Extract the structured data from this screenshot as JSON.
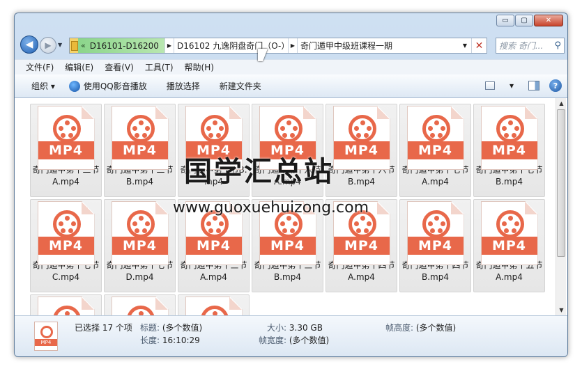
{
  "window": {
    "minimize": "▭",
    "maximize": "▢",
    "close": "✕"
  },
  "address": {
    "history_glyph": "«",
    "crumbs": [
      "D16101-D16200",
      "D16102 九逸阴盘奇门（O-）",
      "奇门遁甲中级班课程一期"
    ],
    "sep_glyph": "▶",
    "dropdown_glyph": "▼",
    "refresh_glyph": "✕"
  },
  "search": {
    "placeholder": "搜索 奇门...",
    "icon": "search-icon"
  },
  "menu": [
    "文件(F)",
    "编辑(E)",
    "查看(V)",
    "工具(T)",
    "帮助(H)"
  ],
  "toolbar": {
    "organize": "组织 ▾",
    "qq_play": "使用QQ影音播放",
    "play_selection": "播放选择",
    "new_folder": "新建文件夹",
    "help": "?"
  },
  "files": [
    {
      "name": "奇门遁甲第十二节A.mp4",
      "badge": "MP4"
    },
    {
      "name": "奇门遁甲第十二节B.mp4",
      "badge": "MP4"
    },
    {
      "name": "奇门遁甲第十节B.mp4",
      "badge": "MP4"
    },
    {
      "name": "奇门遁甲第十六节A.mp4",
      "badge": "MP4"
    },
    {
      "name": "奇门遁甲第十六节B.mp4",
      "badge": "MP4"
    },
    {
      "name": "奇门遁甲第十七节A.mp4",
      "badge": "MP4"
    },
    {
      "name": "奇门遁甲第十七节B.mp4",
      "badge": "MP4"
    },
    {
      "name": "奇门遁甲第十七节C.mp4",
      "badge": "MP4"
    },
    {
      "name": "奇门遁甲第十七节D.mp4",
      "badge": "MP4"
    },
    {
      "name": "奇门遁甲第十三节A.mp4",
      "badge": "MP4"
    },
    {
      "name": "奇门遁甲第十三节B.mp4",
      "badge": "MP4"
    },
    {
      "name": "奇门遁甲第十四节A.mp4",
      "badge": "MP4"
    },
    {
      "name": "奇门遁甲第十四节B.mp4",
      "badge": "MP4"
    },
    {
      "name": "奇门遁甲第十五节A.mp4",
      "badge": "MP4"
    },
    {
      "name": "",
      "badge": ""
    },
    {
      "name": "",
      "badge": ""
    },
    {
      "name": "",
      "badge": ""
    }
  ],
  "details": {
    "selected": "已选择 17 个项",
    "title_key": "标题:",
    "title_val": "(多个数值)",
    "size_key": "大小:",
    "size_val": "3.30 GB",
    "frame_h_key": "帧高度:",
    "frame_h_val": "(多个数值)",
    "length_key": "长度:",
    "length_val": "16:10:29",
    "frame_w_key": "帧宽度:",
    "frame_w_val": "(多个数值)",
    "icon_badge": "MP4"
  },
  "watermark": {
    "title": "国学汇总站",
    "url": "www.guoxuehuizong.com"
  },
  "colors": {
    "mp4_accent": "#e8684a",
    "frame": "#b9d0ea"
  }
}
